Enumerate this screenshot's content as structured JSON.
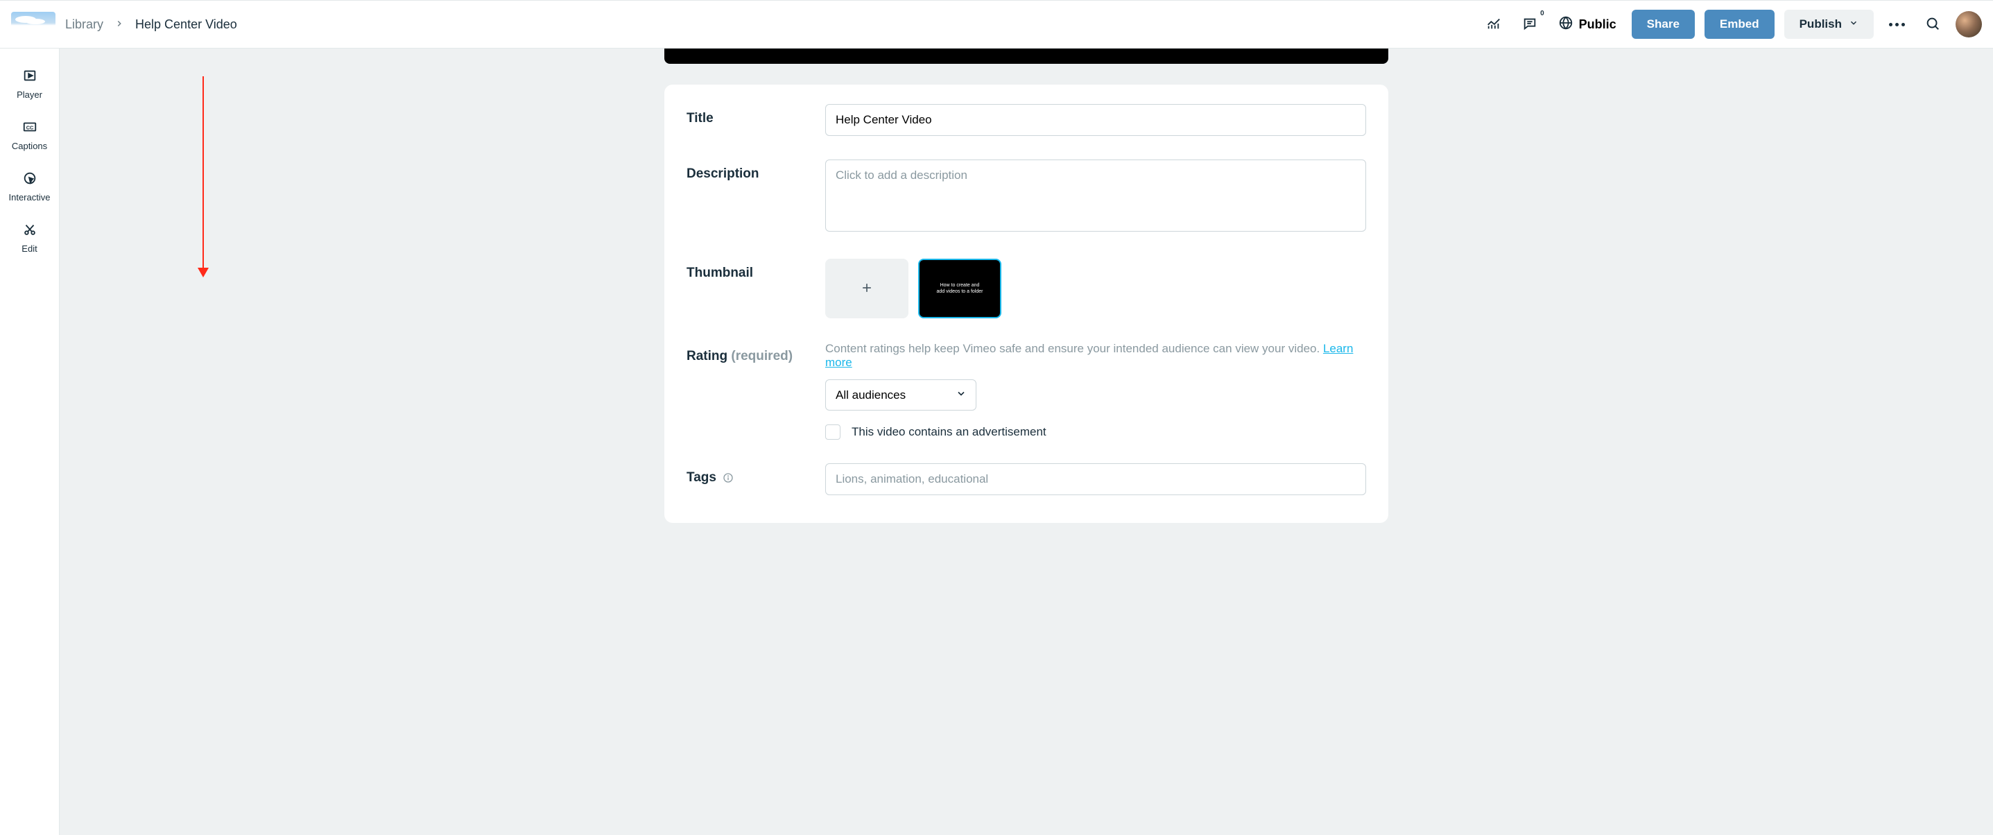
{
  "breadcrumb": {
    "root": "Library",
    "current": "Help Center Video"
  },
  "topbar": {
    "comments_badge": "0",
    "public_label": "Public",
    "share_label": "Share",
    "embed_label": "Embed",
    "publish_label": "Publish"
  },
  "sidebar": {
    "items": [
      {
        "label": "Player"
      },
      {
        "label": "Captions"
      },
      {
        "label": "Interactive"
      },
      {
        "label": "Edit"
      }
    ]
  },
  "form": {
    "title": {
      "label": "Title",
      "value": "Help Center Video"
    },
    "description": {
      "label": "Description",
      "placeholder": "Click to add a description"
    },
    "thumbnail": {
      "label": "Thumbnail",
      "selected_caption": "How to create and\nadd videos to a folder"
    },
    "rating": {
      "label": "Rating",
      "required_text": "(required)",
      "help_text": "Content ratings help keep Vimeo safe and ensure your intended audience can view your video. ",
      "learn_more": "Learn more",
      "selected": "All audiences",
      "ad_checkbox_label": "This video contains an advertisement"
    },
    "tags": {
      "label": "Tags",
      "placeholder": "Lions, animation, educational"
    }
  }
}
